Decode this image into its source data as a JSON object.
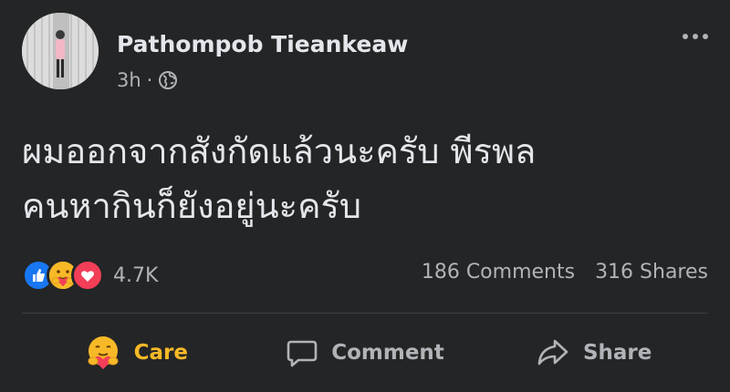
{
  "post": {
    "author": "Pathompob Tieankeaw",
    "time": "3h",
    "separator": "·",
    "audience_icon": "globe-icon",
    "text_lines": [
      "ผมออกจากสังกัดแล้วนะครับ พีรพล",
      "คนหากินก็ยังอยู่นะครับ"
    ]
  },
  "stats": {
    "reactions": [
      "like-icon",
      "care-icon",
      "love-icon"
    ],
    "reaction_count": "4.7K",
    "comments": "186 Comments",
    "shares": "316 Shares"
  },
  "actions": {
    "care_label": "Care",
    "comment_label": "Comment",
    "share_label": "Share"
  },
  "colors": {
    "background": "#242526",
    "text": "#e4e6eb",
    "secondary": "#b0b3b8",
    "care": "#f7b928",
    "like": "#1877f2",
    "love": "#f33e58"
  }
}
